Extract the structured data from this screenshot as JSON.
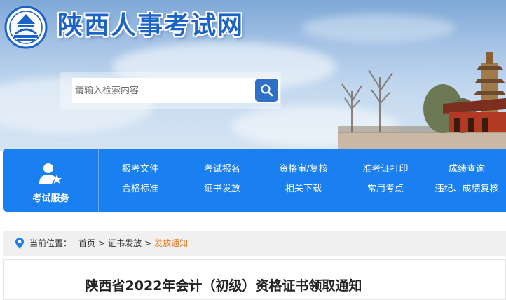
{
  "header": {
    "site_title": "陕西人事考试网",
    "logo_icon": "shaanxi-logo-icon"
  },
  "search": {
    "placeholder": "请输入检索内容",
    "icon": "search-icon"
  },
  "nav": {
    "service_label": "考试服务",
    "service_icon": "user-star-icon",
    "row1": [
      "报考文件",
      "考试报名",
      "资格审/复核",
      "准考证打印",
      "成绩查询"
    ],
    "row2": [
      "合格标准",
      "证书发放",
      "相关下载",
      "常用考点",
      "违纪、成绩复核"
    ]
  },
  "breadcrumb": {
    "prefix": "当前位置：",
    "items": [
      "首页",
      "证书发放",
      "发放通知"
    ],
    "separator": ">"
  },
  "article": {
    "title": "陕西省2022年会计（初级）资格证书领取通知"
  },
  "colors": {
    "nav_bg": "#1a7ff0",
    "title_blue": "#1c63c7",
    "crumb_active": "#e8771a"
  }
}
